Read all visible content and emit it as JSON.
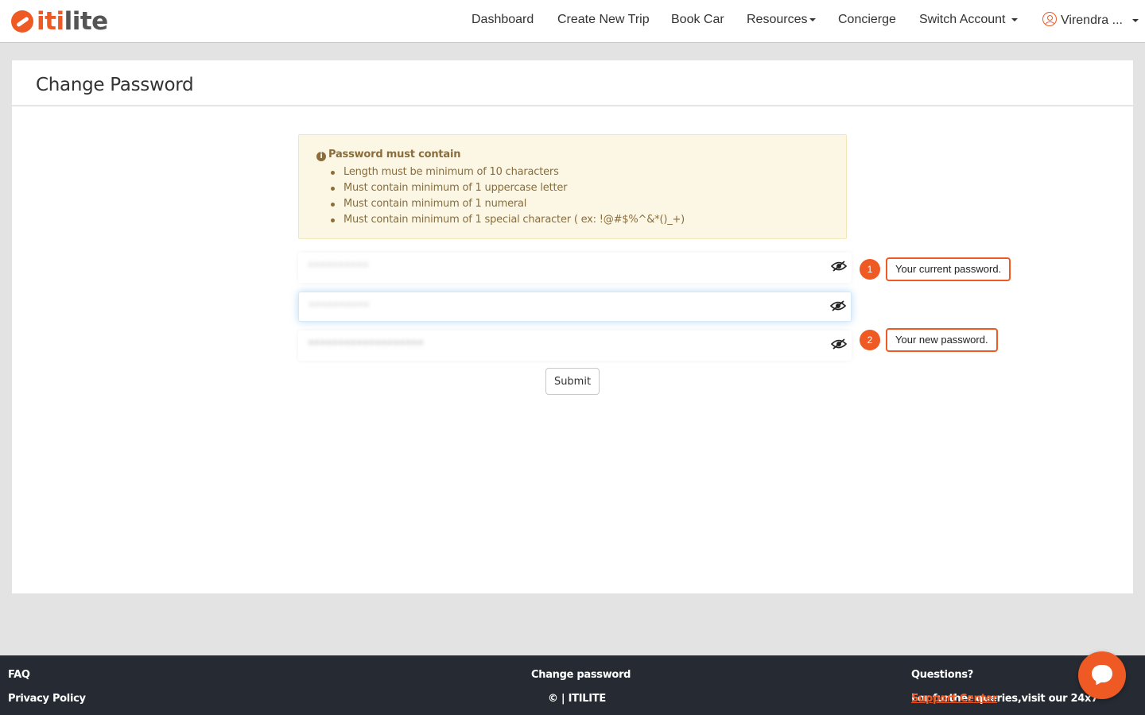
{
  "app": {
    "logo_text_accent": "iti",
    "logo_text_rest": "lite",
    "brand_color": "#ef5a24"
  },
  "nav": {
    "dashboard": "Dashboard",
    "create_trip": "Create New Trip",
    "book_car": "Book Car",
    "resources": "Resources",
    "concierge": "Concierge",
    "switch_account": "Switch Account",
    "user": "Virendra ..."
  },
  "page": {
    "title": "Change Password"
  },
  "rules": {
    "heading": "Password must contain",
    "items": [
      "Length must be minimum of 10 characters",
      "Must contain minimum of 1 uppercase letter",
      "Must contain minimum of 1 numeral",
      "Must contain minimum of 1 special character ( ex: !@#$%^&*()_+)"
    ]
  },
  "form": {
    "submit_label": "Submit"
  },
  "callouts": [
    {
      "number": "1",
      "text": "Your current password."
    },
    {
      "number": "2",
      "text": "Your new password."
    }
  ],
  "footer": {
    "faq": "FAQ",
    "privacy": "Privacy Policy",
    "center_title": "Change password",
    "copyright": "© | ITILITE",
    "questions": "Questions?",
    "queries_text": "For further queries,visit our 24x7",
    "support_link": "Support Center"
  }
}
